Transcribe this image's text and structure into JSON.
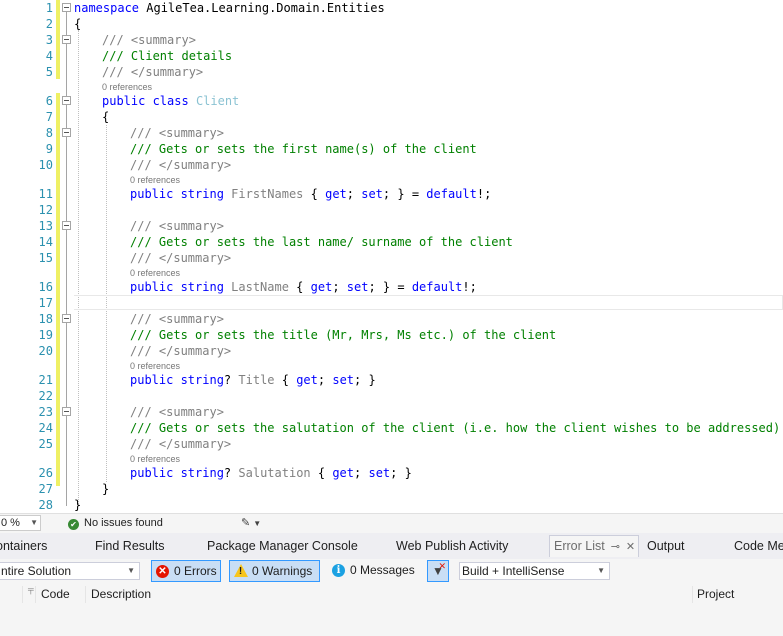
{
  "editor": {
    "line_numbers": [
      "1",
      "2",
      "3",
      "4",
      "5",
      "6",
      "7",
      "8",
      "9",
      "10",
      "11",
      "12",
      "13",
      "14",
      "15",
      "16",
      "17",
      "18",
      "19",
      "20",
      "21",
      "22",
      "23",
      "24",
      "25",
      "26",
      "27",
      "28"
    ],
    "lines": {
      "l1_kw": "namespace",
      "l1_ns": " AgileTea.Learning.Domain.Entities",
      "l2": "{",
      "l3": "/// <summary>",
      "l4": "/// Client details",
      "l5": "/// </summary>",
      "l6_kw": "public class",
      "l6_type": "Client",
      "l7": "{",
      "l8": "/// <summary>",
      "l9": "/// Gets or sets the first name(s) of the client",
      "l10": "/// </summary>",
      "l11_kw": "public string",
      "l11_name": "FirstNames",
      "l11_b1": " { ",
      "l11_get": "get",
      "l11_semi1": "; ",
      "l11_set": "set",
      "l11_b2": "; } = ",
      "l11_def": "default",
      "l11_end": "!;",
      "l13": "/// <summary>",
      "l14": "/// Gets or sets the last name/ surname of the client",
      "l15": "/// </summary>",
      "l16_kw": "public string",
      "l16_name": "LastName",
      "l16_b1": " { ",
      "l16_get": "get",
      "l16_semi1": "; ",
      "l16_set": "set",
      "l16_b2": "; } = ",
      "l16_def": "default",
      "l16_end": "!;",
      "l18": "/// <summary>",
      "l19": "/// Gets or sets the title (Mr, Mrs, Ms etc.) of the client",
      "l20": "/// </summary>",
      "l21_kw": "public string",
      "l21_q": "?",
      "l21_name": "Title",
      "l21_b1": " { ",
      "l21_get": "get",
      "l21_semi1": "; ",
      "l21_set": "set",
      "l21_end": "; }",
      "l23": "/// <summary>",
      "l24": "/// Gets or sets the salutation of the client (i.e. how the client wishes to be addressed)",
      "l25": "/// </summary>",
      "l26_kw": "public string",
      "l26_q": "?",
      "l26_name": "Salutation",
      "l26_b1": " { ",
      "l26_get": "get",
      "l26_semi1": "; ",
      "l26_set": "set",
      "l26_end": "; }",
      "l27": "}",
      "l28": "}"
    },
    "codelens": "0 references"
  },
  "status_bar": {
    "zoom": "0 %",
    "issues": "No issues found"
  },
  "tool_tabs": {
    "containers": "ontainers",
    "find_results": "Find Results",
    "package_manager": "Package Manager Console",
    "web_publish": "Web Publish Activity",
    "error_list": "Error List",
    "output": "Output",
    "code_metrics": "Code Met"
  },
  "error_list": {
    "scope": "ntire Solution",
    "errors": "0 Errors",
    "warnings": "0 Warnings",
    "messages": "0 Messages",
    "build_filter": "Build + IntelliSense",
    "columns": {
      "code": "Code",
      "description": "Description",
      "project": "Project"
    }
  },
  "colors": {
    "keyword": "#0000ff",
    "comment": "#008000",
    "line_number": "#2b91af",
    "change_bar": "#eff064",
    "error": "#e51400",
    "warning": "#f8c51c",
    "info": "#1ba1e2"
  }
}
